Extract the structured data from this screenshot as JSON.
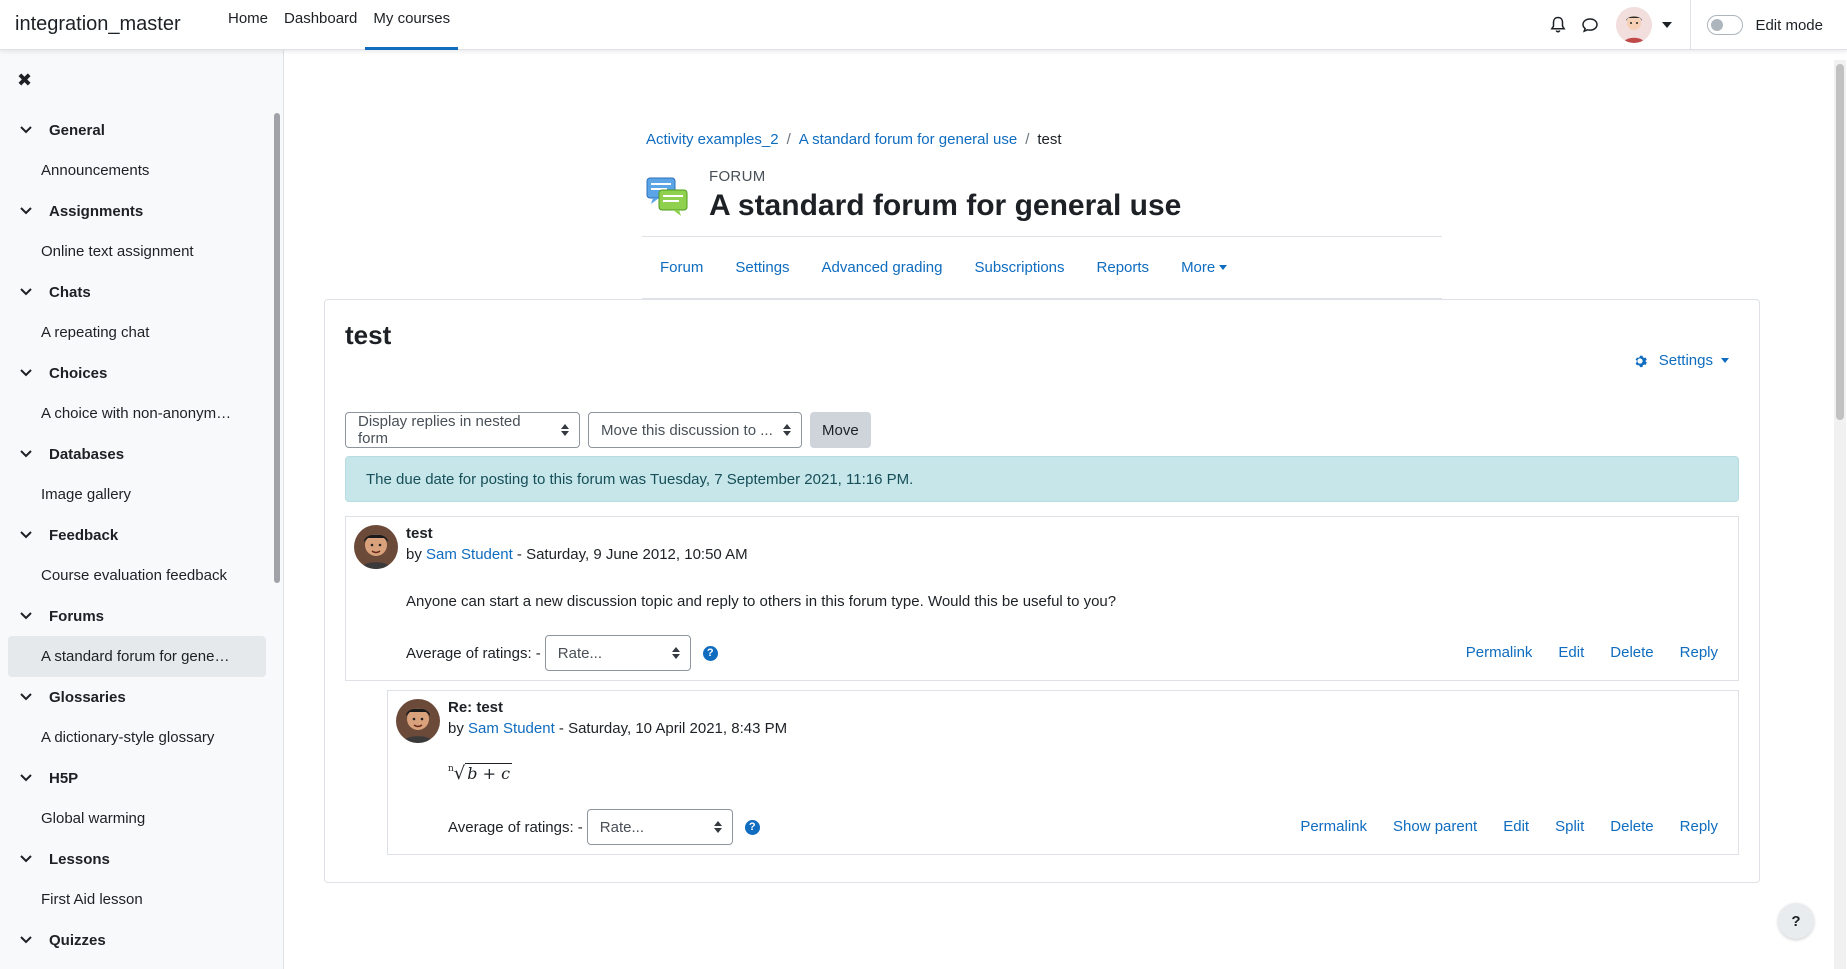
{
  "navbar": {
    "site_name": "integration_master",
    "links": [
      "Home",
      "Dashboard",
      "My courses"
    ],
    "active_link": "My courses",
    "edit_mode_label": "Edit mode"
  },
  "sidebar": {
    "sections": [
      {
        "title": "General",
        "item": "Announcements"
      },
      {
        "title": "Assignments",
        "item": "Online text assignment"
      },
      {
        "title": "Chats",
        "item": "A repeating chat"
      },
      {
        "title": "Choices",
        "item": "A choice with non-anonym…"
      },
      {
        "title": "Databases",
        "item": "Image gallery"
      },
      {
        "title": "Feedback",
        "item": "Course evaluation feedback"
      },
      {
        "title": "Forums",
        "item": "A standard forum for gene…"
      },
      {
        "title": "Glossaries",
        "item": "A dictionary-style glossary"
      },
      {
        "title": "H5P",
        "item": "Global warming"
      },
      {
        "title": "Lessons",
        "item": "First Aid lesson"
      },
      {
        "title": "Quizzes",
        "item": ""
      }
    ]
  },
  "breadcrumb": [
    "Activity examples_2",
    "A standard forum for general use",
    "test"
  ],
  "header": {
    "module_label": "FORUM",
    "title": "A standard forum for general use"
  },
  "secondary_nav": [
    "Forum",
    "Settings",
    "Advanced grading",
    "Subscriptions",
    "Reports",
    "More"
  ],
  "discussion": {
    "title": "test",
    "settings_label": "Settings",
    "display_mode": "Display replies in nested form",
    "move_select": "Move this discussion to ...",
    "move_button": "Move",
    "alert": "The due date for posting to this forum was Tuesday, 7 September 2021, 11:16 PM."
  },
  "posts": [
    {
      "subject": "test",
      "by": "by ",
      "author": "Sam Student",
      "date": " - Saturday, 9 June 2012, 10:50 AM",
      "body": "Anyone can start a new discussion topic and reply to others in this forum type. Would this be useful to you?",
      "ratings_label": "Average of ratings: -",
      "rate_placeholder": "Rate...",
      "actions": [
        "Permalink",
        "Edit",
        "Delete",
        "Reply"
      ]
    },
    {
      "subject": "Re: test",
      "by": "by ",
      "author": "Sam Student",
      "date": " - Saturday, 10 April 2021, 8:43 PM",
      "body_math": "b + c",
      "ratings_label": "Average of ratings: -",
      "rate_placeholder": "Rate...",
      "actions": [
        "Permalink",
        "Show parent",
        "Edit",
        "Split",
        "Delete",
        "Reply"
      ]
    }
  ],
  "help_button": "?"
}
